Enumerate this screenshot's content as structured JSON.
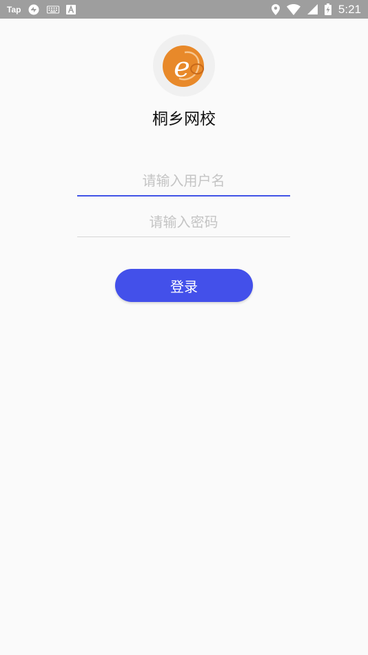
{
  "status_bar": {
    "app_label": "Tap",
    "time": "5:21",
    "icons": [
      "sync-icon",
      "keyboard-icon",
      "a-badge-icon",
      "location-icon",
      "wifi-icon",
      "signal-icon",
      "battery-icon"
    ]
  },
  "app": {
    "name": "桐乡网校",
    "logo_letter": "e",
    "brand_color": "#e8892a"
  },
  "login": {
    "username_placeholder": "请输入用户名",
    "password_placeholder": "请输入密码",
    "submit_label": "登录",
    "accent_color": "#4350ea"
  }
}
